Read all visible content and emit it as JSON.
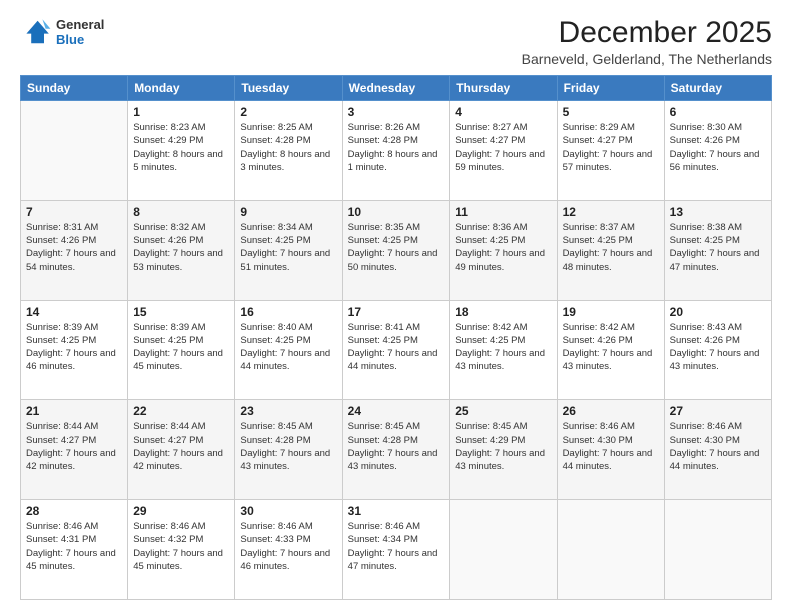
{
  "logo": {
    "line1": "General",
    "line2": "Blue"
  },
  "title": "December 2025",
  "subtitle": "Barneveld, Gelderland, The Netherlands",
  "weekdays": [
    "Sunday",
    "Monday",
    "Tuesday",
    "Wednesday",
    "Thursday",
    "Friday",
    "Saturday"
  ],
  "weeks": [
    [
      {
        "day": "",
        "sunrise": "",
        "sunset": "",
        "daylight": ""
      },
      {
        "day": "1",
        "sunrise": "Sunrise: 8:23 AM",
        "sunset": "Sunset: 4:29 PM",
        "daylight": "Daylight: 8 hours and 5 minutes."
      },
      {
        "day": "2",
        "sunrise": "Sunrise: 8:25 AM",
        "sunset": "Sunset: 4:28 PM",
        "daylight": "Daylight: 8 hours and 3 minutes."
      },
      {
        "day": "3",
        "sunrise": "Sunrise: 8:26 AM",
        "sunset": "Sunset: 4:28 PM",
        "daylight": "Daylight: 8 hours and 1 minute."
      },
      {
        "day": "4",
        "sunrise": "Sunrise: 8:27 AM",
        "sunset": "Sunset: 4:27 PM",
        "daylight": "Daylight: 7 hours and 59 minutes."
      },
      {
        "day": "5",
        "sunrise": "Sunrise: 8:29 AM",
        "sunset": "Sunset: 4:27 PM",
        "daylight": "Daylight: 7 hours and 57 minutes."
      },
      {
        "day": "6",
        "sunrise": "Sunrise: 8:30 AM",
        "sunset": "Sunset: 4:26 PM",
        "daylight": "Daylight: 7 hours and 56 minutes."
      }
    ],
    [
      {
        "day": "7",
        "sunrise": "Sunrise: 8:31 AM",
        "sunset": "Sunset: 4:26 PM",
        "daylight": "Daylight: 7 hours and 54 minutes."
      },
      {
        "day": "8",
        "sunrise": "Sunrise: 8:32 AM",
        "sunset": "Sunset: 4:26 PM",
        "daylight": "Daylight: 7 hours and 53 minutes."
      },
      {
        "day": "9",
        "sunrise": "Sunrise: 8:34 AM",
        "sunset": "Sunset: 4:25 PM",
        "daylight": "Daylight: 7 hours and 51 minutes."
      },
      {
        "day": "10",
        "sunrise": "Sunrise: 8:35 AM",
        "sunset": "Sunset: 4:25 PM",
        "daylight": "Daylight: 7 hours and 50 minutes."
      },
      {
        "day": "11",
        "sunrise": "Sunrise: 8:36 AM",
        "sunset": "Sunset: 4:25 PM",
        "daylight": "Daylight: 7 hours and 49 minutes."
      },
      {
        "day": "12",
        "sunrise": "Sunrise: 8:37 AM",
        "sunset": "Sunset: 4:25 PM",
        "daylight": "Daylight: 7 hours and 48 minutes."
      },
      {
        "day": "13",
        "sunrise": "Sunrise: 8:38 AM",
        "sunset": "Sunset: 4:25 PM",
        "daylight": "Daylight: 7 hours and 47 minutes."
      }
    ],
    [
      {
        "day": "14",
        "sunrise": "Sunrise: 8:39 AM",
        "sunset": "Sunset: 4:25 PM",
        "daylight": "Daylight: 7 hours and 46 minutes."
      },
      {
        "day": "15",
        "sunrise": "Sunrise: 8:39 AM",
        "sunset": "Sunset: 4:25 PM",
        "daylight": "Daylight: 7 hours and 45 minutes."
      },
      {
        "day": "16",
        "sunrise": "Sunrise: 8:40 AM",
        "sunset": "Sunset: 4:25 PM",
        "daylight": "Daylight: 7 hours and 44 minutes."
      },
      {
        "day": "17",
        "sunrise": "Sunrise: 8:41 AM",
        "sunset": "Sunset: 4:25 PM",
        "daylight": "Daylight: 7 hours and 44 minutes."
      },
      {
        "day": "18",
        "sunrise": "Sunrise: 8:42 AM",
        "sunset": "Sunset: 4:25 PM",
        "daylight": "Daylight: 7 hours and 43 minutes."
      },
      {
        "day": "19",
        "sunrise": "Sunrise: 8:42 AM",
        "sunset": "Sunset: 4:26 PM",
        "daylight": "Daylight: 7 hours and 43 minutes."
      },
      {
        "day": "20",
        "sunrise": "Sunrise: 8:43 AM",
        "sunset": "Sunset: 4:26 PM",
        "daylight": "Daylight: 7 hours and 43 minutes."
      }
    ],
    [
      {
        "day": "21",
        "sunrise": "Sunrise: 8:44 AM",
        "sunset": "Sunset: 4:27 PM",
        "daylight": "Daylight: 7 hours and 42 minutes."
      },
      {
        "day": "22",
        "sunrise": "Sunrise: 8:44 AM",
        "sunset": "Sunset: 4:27 PM",
        "daylight": "Daylight: 7 hours and 42 minutes."
      },
      {
        "day": "23",
        "sunrise": "Sunrise: 8:45 AM",
        "sunset": "Sunset: 4:28 PM",
        "daylight": "Daylight: 7 hours and 43 minutes."
      },
      {
        "day": "24",
        "sunrise": "Sunrise: 8:45 AM",
        "sunset": "Sunset: 4:28 PM",
        "daylight": "Daylight: 7 hours and 43 minutes."
      },
      {
        "day": "25",
        "sunrise": "Sunrise: 8:45 AM",
        "sunset": "Sunset: 4:29 PM",
        "daylight": "Daylight: 7 hours and 43 minutes."
      },
      {
        "day": "26",
        "sunrise": "Sunrise: 8:46 AM",
        "sunset": "Sunset: 4:30 PM",
        "daylight": "Daylight: 7 hours and 44 minutes."
      },
      {
        "day": "27",
        "sunrise": "Sunrise: 8:46 AM",
        "sunset": "Sunset: 4:30 PM",
        "daylight": "Daylight: 7 hours and 44 minutes."
      }
    ],
    [
      {
        "day": "28",
        "sunrise": "Sunrise: 8:46 AM",
        "sunset": "Sunset: 4:31 PM",
        "daylight": "Daylight: 7 hours and 45 minutes."
      },
      {
        "day": "29",
        "sunrise": "Sunrise: 8:46 AM",
        "sunset": "Sunset: 4:32 PM",
        "daylight": "Daylight: 7 hours and 45 minutes."
      },
      {
        "day": "30",
        "sunrise": "Sunrise: 8:46 AM",
        "sunset": "Sunset: 4:33 PM",
        "daylight": "Daylight: 7 hours and 46 minutes."
      },
      {
        "day": "31",
        "sunrise": "Sunrise: 8:46 AM",
        "sunset": "Sunset: 4:34 PM",
        "daylight": "Daylight: 7 hours and 47 minutes."
      },
      {
        "day": "",
        "sunrise": "",
        "sunset": "",
        "daylight": ""
      },
      {
        "day": "",
        "sunrise": "",
        "sunset": "",
        "daylight": ""
      },
      {
        "day": "",
        "sunrise": "",
        "sunset": "",
        "daylight": ""
      }
    ]
  ]
}
